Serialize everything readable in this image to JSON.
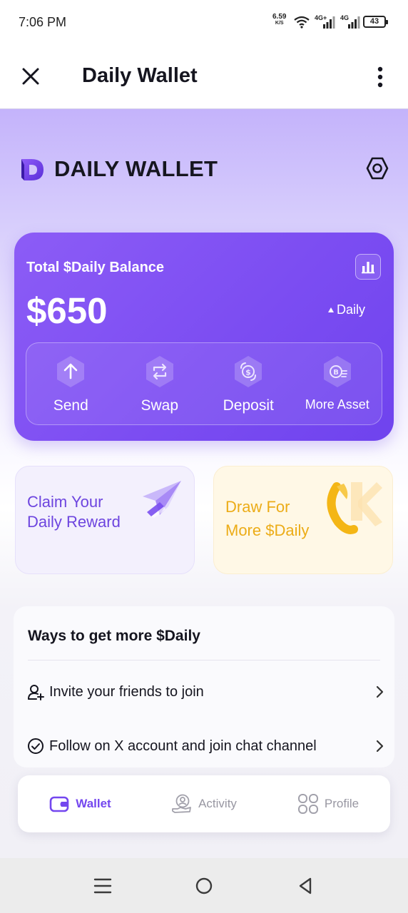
{
  "status_bar": {
    "time": "7:06 PM",
    "net_speed": "6.59",
    "net_unit": "K/S",
    "sim1_label": "4G+",
    "sim2_label": "4G",
    "battery": "43"
  },
  "app_bar": {
    "title": "Daily Wallet",
    "close_icon": "close-icon",
    "menu_icon": "more-vertical-icon"
  },
  "brand": {
    "logo_letter": "D",
    "name": "DAILY WALLET"
  },
  "balance": {
    "label": "Total $Daily Balance",
    "amount": "$650",
    "ticker": "Daily",
    "actions": [
      {
        "label": "Send",
        "icon": "arrow-up-icon"
      },
      {
        "label": "Swap",
        "icon": "swap-icon"
      },
      {
        "label": "Deposit",
        "icon": "deposit-icon"
      },
      {
        "label": "More Asset",
        "icon": "bitcoin-icon"
      }
    ]
  },
  "promos": {
    "claim": {
      "line1": "Claim Your",
      "line2": "Daily Reward"
    },
    "draw": {
      "line1": "Draw For",
      "line2": "More $Daily"
    }
  },
  "ways": {
    "title": "Ways to get more $Daily",
    "items": [
      {
        "label": "Invite your friends to join",
        "icon": "add-user-icon"
      },
      {
        "label": "Follow on X account and join chat channel",
        "icon": "check-circle-icon"
      }
    ]
  },
  "tabs": [
    {
      "label": "Wallet",
      "icon": "wallet-icon",
      "active": true
    },
    {
      "label": "Activity",
      "icon": "activity-icon",
      "active": false
    },
    {
      "label": "Profile",
      "icon": "profile-grid-icon",
      "active": false
    }
  ],
  "colors": {
    "accent": "#7447EF",
    "card": "#7C4DF2",
    "draw_text": "#ECAC17"
  }
}
